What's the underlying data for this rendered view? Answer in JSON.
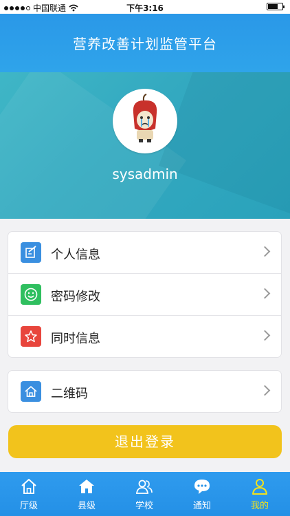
{
  "status_bar": {
    "carrier": "中国联通",
    "time": "下午3:16"
  },
  "header": {
    "title": "营养改善计划监管平台"
  },
  "profile": {
    "username": "sysadmin"
  },
  "menu": {
    "items": [
      {
        "label": "个人信息",
        "icon": "edit-icon",
        "color": "#3a8fe0"
      },
      {
        "label": "密码修改",
        "icon": "smile-icon",
        "color": "#2fbf5f"
      },
      {
        "label": "同时信息",
        "icon": "star-icon",
        "color": "#e8453c"
      }
    ]
  },
  "qr": {
    "label": "二维码",
    "icon": "home-icon",
    "color": "#3a8fe0"
  },
  "logout": {
    "label": "退出登录",
    "color": "#f2c31c"
  },
  "tabbar": {
    "tabs": [
      {
        "label": "厅级",
        "icon": "home-outline-icon"
      },
      {
        "label": "县级",
        "icon": "home-filled-icon"
      },
      {
        "label": "学校",
        "icon": "users-icon"
      },
      {
        "label": "通知",
        "icon": "chat-icon"
      },
      {
        "label": "我的",
        "icon": "person-icon",
        "active": true
      }
    ],
    "accent": "#f2e21c"
  }
}
